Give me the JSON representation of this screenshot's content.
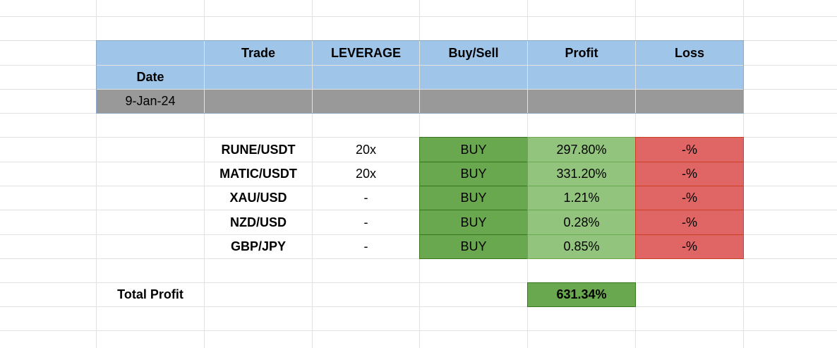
{
  "header": {
    "trade": "Trade",
    "leverage": "LEVERAGE",
    "buy_sell": "Buy/Sell",
    "profit": "Profit",
    "loss": "Loss",
    "date": "Date"
  },
  "date_value": "9-Jan-24",
  "rows": [
    {
      "trade": "RUNE/USDT",
      "leverage": "20x",
      "side": "BUY",
      "profit": "297.80%",
      "loss": "-%"
    },
    {
      "trade": "MATIC/USDT",
      "leverage": "20x",
      "side": "BUY",
      "profit": "331.20%",
      "loss": "-%"
    },
    {
      "trade": "XAU/USD",
      "leverage": "-",
      "side": "BUY",
      "profit": "1.21%",
      "loss": "-%"
    },
    {
      "trade": "NZD/USD",
      "leverage": "-",
      "side": "BUY",
      "profit": "0.28%",
      "loss": "-%"
    },
    {
      "trade": "GBP/JPY",
      "leverage": "-",
      "side": "BUY",
      "profit": "0.85%",
      "loss": "-%"
    }
  ],
  "total": {
    "label": "Total Profit",
    "value": "631.34%"
  },
  "colors": {
    "header_blue": "#9fc5e8",
    "date_grey": "#999999",
    "buy_green": "#6aa84f",
    "profit_green": "#93c47d",
    "loss_red": "#e06666"
  }
}
